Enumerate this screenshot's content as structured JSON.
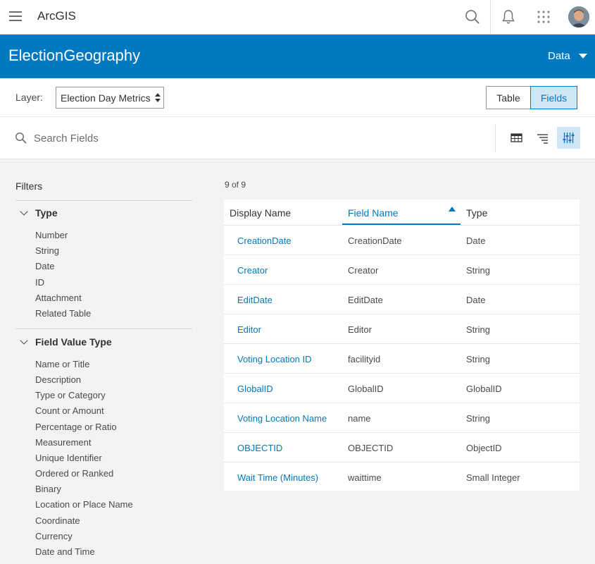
{
  "topnav": {
    "app_title": "ArcGIS",
    "icons": [
      "menu-icon",
      "search-icon",
      "bell-icon",
      "apps-grid-icon",
      "user-avatar"
    ]
  },
  "header": {
    "title": "ElectionGeography",
    "menu_label": "Data"
  },
  "layer": {
    "label": "Layer:",
    "selected": "Election Day Metrics"
  },
  "view_toggle": {
    "table_label": "Table",
    "fields_label": "Fields",
    "active": "Fields"
  },
  "search": {
    "placeholder": "Search Fields"
  },
  "filters": {
    "title": "Filters",
    "groups": [
      {
        "label": "Type",
        "items": [
          "Number",
          "String",
          "Date",
          "ID",
          "Attachment",
          "Related Table"
        ]
      },
      {
        "label": "Field Value Type",
        "items": [
          "Name or Title",
          "Description",
          "Type or Category",
          "Count or Amount",
          "Percentage or Ratio",
          "Measurement",
          "Unique Identifier",
          "Ordered or Ranked",
          "Binary",
          "Location or Place Name",
          "Coordinate",
          "Currency",
          "Date and Time"
        ]
      }
    ]
  },
  "table": {
    "count": "9 of 9",
    "columns": [
      "Display Name",
      "Field Name",
      "Type"
    ],
    "sorted_column": "Field Name",
    "rows": [
      {
        "display": "CreationDate",
        "field": "CreationDate",
        "type": "Date"
      },
      {
        "display": "Creator",
        "field": "Creator",
        "type": "String"
      },
      {
        "display": "EditDate",
        "field": "EditDate",
        "type": "Date"
      },
      {
        "display": "Editor",
        "field": "Editor",
        "type": "String"
      },
      {
        "display": "Voting Location ID",
        "field": "facilityid",
        "type": "String"
      },
      {
        "display": "GlobalID",
        "field": "GlobalID",
        "type": "GlobalID"
      },
      {
        "display": "Voting Location Name",
        "field": "name",
        "type": "String"
      },
      {
        "display": "OBJECTID",
        "field": "OBJECTID",
        "type": "ObjectID"
      },
      {
        "display": "Wait Time (Minutes)",
        "field": "waittime",
        "type": "Small Integer"
      }
    ]
  },
  "colors": {
    "brand_blue": "#0079c1",
    "active_bg": "#cfe6f5"
  }
}
